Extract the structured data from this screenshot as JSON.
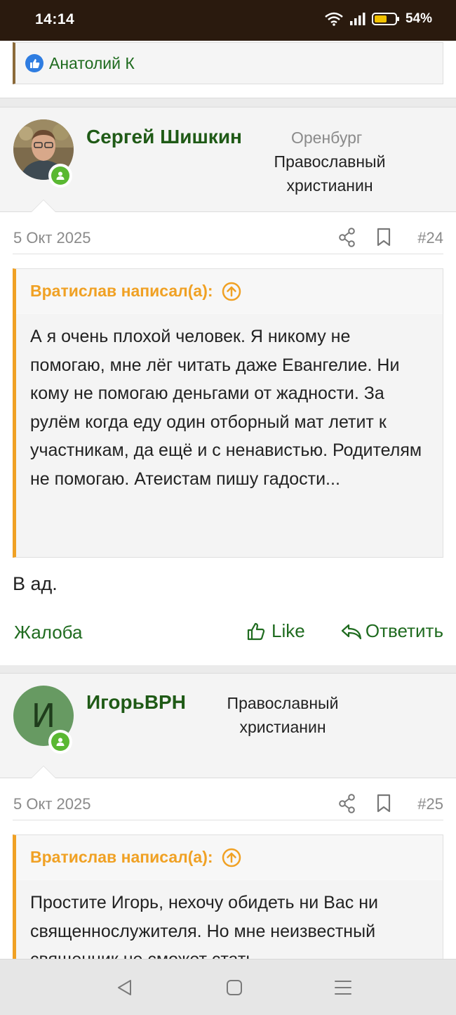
{
  "status": {
    "time": "14:14",
    "battery": "54%"
  },
  "reaction": {
    "name": "Анатолий К"
  },
  "posts": [
    {
      "author": "Сергей Шишкин",
      "location": "Оренбург",
      "title_line1": "Православный",
      "title_line2": "христианин",
      "date": "5 Окт 2025",
      "number": "#24",
      "quote_author": "Вратислав написал(а):",
      "quote_text": "А я очень плохой человек. Я никому не помогаю, мне лёг читать даже Евангелие. Ни кому не помогаю деньгами от жадности. За рулём когда еду один отборный мат летит к участникам, да ещё и с ненавистью. Родителям не помогаю. Атеистам пишу гадости...",
      "text": "В ад.",
      "report": "Жалоба",
      "like": "Like",
      "reply": "Ответить"
    },
    {
      "author": "ИгорьВРН",
      "avatar_letter": "И",
      "title_line1": "Православный",
      "title_line2": "христианин",
      "date": "5 Окт 2025",
      "number": "#25",
      "quote_author": "Вратислав написал(а):",
      "quote_text": "Простите Игорь, нехочу обидеть ни Вас ни священнослужителя. Но мне неизвестный священник не сможет стать"
    }
  ],
  "colors": {
    "accent_green": "#1f6b1f",
    "quote_orange": "#f0a124",
    "online_green": "#5ab832"
  }
}
